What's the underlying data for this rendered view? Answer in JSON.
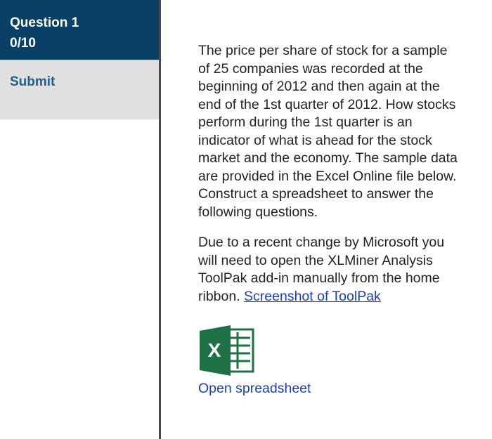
{
  "sidebar": {
    "question_title": "Question 1",
    "score": "0/10",
    "submit_label": "Submit"
  },
  "content": {
    "paragraph1": "The price per share of stock for a sample of 25 companies was recorded at the beginning of 2012 and then again at the end of the 1st quarter of 2012. How stocks perform during the 1st quarter is an indicator of what is ahead for the stock market and the economy. The sample data are provided in the Excel Online file below. Construct a spreadsheet to answer the following questions.",
    "paragraph2_text": "Due to a recent change by Microsoft you will need to open the XLMiner Analysis ToolPak add-in manually from the home ribbon. ",
    "paragraph2_link": "Screenshot of ToolPak",
    "excel_icon_letter": "X",
    "open_spreadsheet_label": "Open spreadsheet"
  },
  "colors": {
    "header_bg": "#0a4066",
    "submit_bg": "#e0e0e0",
    "submit_text": "#1f5f8b",
    "link": "#1a3fb8",
    "excel_green": "#1e7145"
  },
  "icons": {
    "excel": "excel-file-icon"
  }
}
